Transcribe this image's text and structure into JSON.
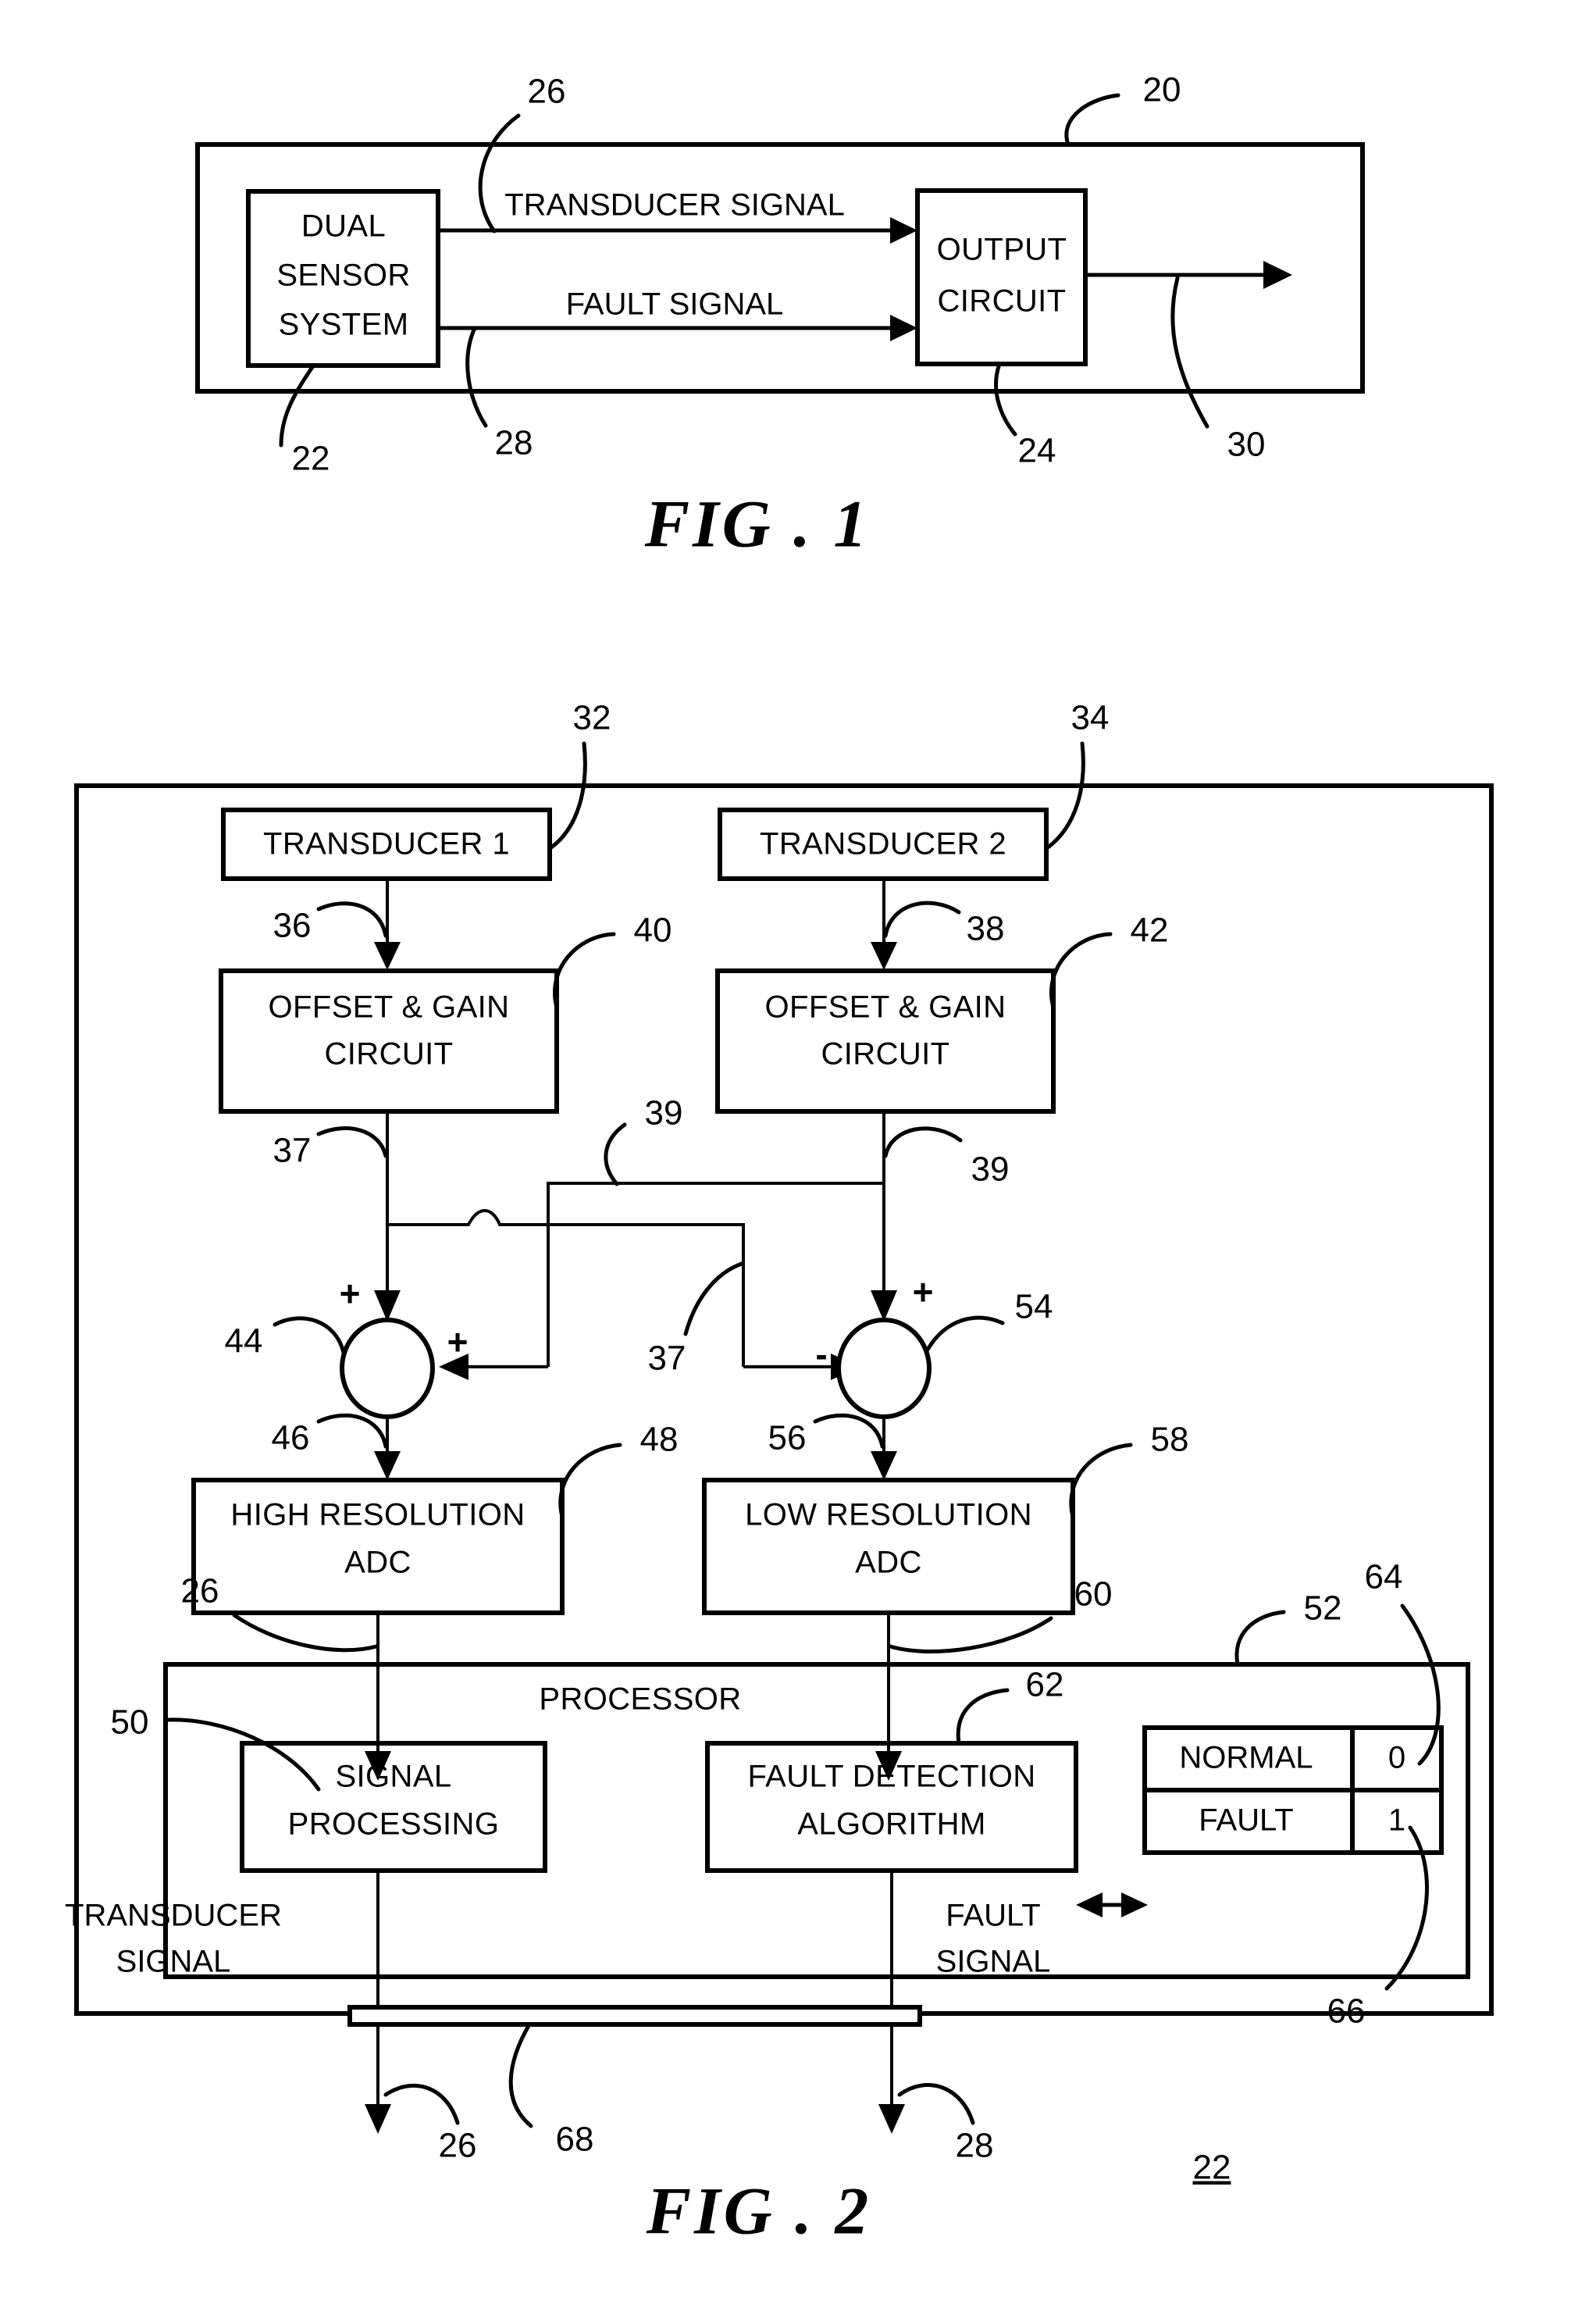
{
  "document": {
    "type": "patent-drawing-sheet",
    "figures": [
      "FIG . 1",
      "FIG . 2"
    ]
  },
  "fig1": {
    "caption": "FIG . 1",
    "outer_ref": "20",
    "blocks": [
      {
        "id": "dual-sensor-system",
        "lines": [
          "DUAL",
          "SENSOR",
          "SYSTEM"
        ],
        "ref": "22"
      },
      {
        "id": "output-circuit",
        "lines": [
          "OUTPUT",
          "CIRCUIT"
        ],
        "ref": "24"
      }
    ],
    "signals": [
      {
        "id": "transducer-signal",
        "label": "TRANSDUCER SIGNAL",
        "ref": "26"
      },
      {
        "id": "fault-signal",
        "label": "FAULT SIGNAL",
        "ref": "28"
      },
      {
        "id": "output-signal",
        "label": "",
        "ref": "30"
      }
    ]
  },
  "fig2": {
    "caption": "FIG . 2",
    "system_ref": "22",
    "blocks": [
      {
        "id": "transducer-1",
        "lines": [
          "TRANSDUCER 1"
        ],
        "ref": "32"
      },
      {
        "id": "transducer-2",
        "lines": [
          "TRANSDUCER 2"
        ],
        "ref": "34"
      },
      {
        "id": "offset-gain-circuit-1",
        "lines": [
          "OFFSET & GAIN",
          "CIRCUIT"
        ],
        "ref": "40"
      },
      {
        "id": "offset-gain-circuit-2",
        "lines": [
          "OFFSET & GAIN",
          "CIRCUIT"
        ],
        "ref": "42"
      },
      {
        "id": "high-resolution-adc",
        "lines": [
          "HIGH RESOLUTION",
          "ADC"
        ],
        "ref": "48"
      },
      {
        "id": "low-resolution-adc",
        "lines": [
          "LOW RESOLUTION",
          "ADC"
        ],
        "ref": "58"
      },
      {
        "id": "processor",
        "lines": [
          "PROCESSOR"
        ],
        "ref": "52"
      },
      {
        "id": "signal-processing",
        "lines": [
          "SIGNAL",
          "PROCESSING"
        ],
        "ref": "50"
      },
      {
        "id": "fault-detection-algorithm",
        "lines": [
          "FAULT DETECTION",
          "ALGORITHM"
        ],
        "ref": "62"
      }
    ],
    "summing_junctions": [
      {
        "id": "summer-left",
        "ref": "44",
        "top_sign": "+",
        "side_sign": "+",
        "output_ref": "46"
      },
      {
        "id": "summer-right",
        "ref": "54",
        "top_sign": "+",
        "side_sign": "-",
        "output_ref": "56"
      }
    ],
    "wire_refs": {
      "transducer1_to_offset1": "36",
      "transducer2_to_offset2": "38",
      "offset1_out_left": "37",
      "offset1_out_cross": "37",
      "offset2_out_left": "39",
      "offset2_out_right": "39",
      "hires_adc_to_processor": "26",
      "lores_adc_to_processor": "60",
      "output_bus": "68",
      "transducer_signal_out": "26",
      "fault_signal_out": "28"
    },
    "status_table": {
      "ref_top": "64",
      "ref_bottom": "66",
      "rows": [
        {
          "state": "NORMAL",
          "value": "0"
        },
        {
          "state": "FAULT",
          "value": "1"
        }
      ]
    },
    "output_labels": [
      {
        "id": "transducer-signal-out-label",
        "lines": [
          "TRANSDUCER",
          "SIGNAL"
        ]
      },
      {
        "id": "fault-signal-out-label",
        "lines": [
          "FAULT",
          "SIGNAL"
        ]
      }
    ]
  }
}
